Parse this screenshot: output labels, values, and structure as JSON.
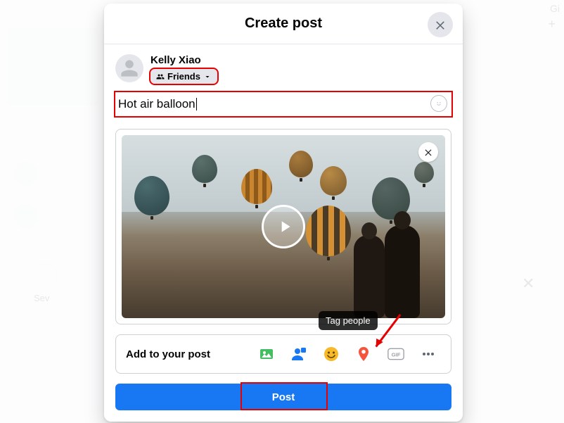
{
  "modal": {
    "title": "Create post",
    "close_icon": "close"
  },
  "user": {
    "name": "Kelly Xiao",
    "audience_label": "Friends"
  },
  "composer": {
    "text": "Hot air balloon"
  },
  "media": {
    "type": "video",
    "remove_icon": "close",
    "play_icon": "play"
  },
  "addto": {
    "label": "Add to your post",
    "tooltip": "Tag people",
    "icons": {
      "photo": "photo-video",
      "tag": "tag-people",
      "feeling": "feeling-activity",
      "checkin": "check-in",
      "gif": "GIF",
      "more": "more"
    }
  },
  "submit": {
    "label": "Post"
  },
  "bg": {
    "truncated_text": "Gi",
    "sev_text": "Sev"
  }
}
